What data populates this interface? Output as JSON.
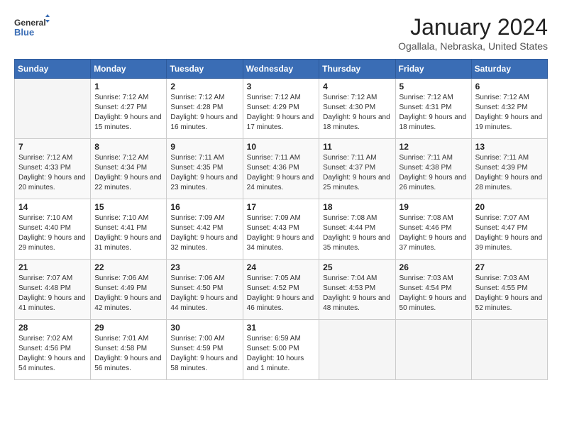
{
  "header": {
    "logo_line1": "General",
    "logo_line2": "Blue",
    "month": "January 2024",
    "location": "Ogallala, Nebraska, United States"
  },
  "weekdays": [
    "Sunday",
    "Monday",
    "Tuesday",
    "Wednesday",
    "Thursday",
    "Friday",
    "Saturday"
  ],
  "weeks": [
    [
      {
        "day": "",
        "sunrise": "",
        "sunset": "",
        "daylight": ""
      },
      {
        "day": "1",
        "sunrise": "Sunrise: 7:12 AM",
        "sunset": "Sunset: 4:27 PM",
        "daylight": "Daylight: 9 hours and 15 minutes."
      },
      {
        "day": "2",
        "sunrise": "Sunrise: 7:12 AM",
        "sunset": "Sunset: 4:28 PM",
        "daylight": "Daylight: 9 hours and 16 minutes."
      },
      {
        "day": "3",
        "sunrise": "Sunrise: 7:12 AM",
        "sunset": "Sunset: 4:29 PM",
        "daylight": "Daylight: 9 hours and 17 minutes."
      },
      {
        "day": "4",
        "sunrise": "Sunrise: 7:12 AM",
        "sunset": "Sunset: 4:30 PM",
        "daylight": "Daylight: 9 hours and 18 minutes."
      },
      {
        "day": "5",
        "sunrise": "Sunrise: 7:12 AM",
        "sunset": "Sunset: 4:31 PM",
        "daylight": "Daylight: 9 hours and 18 minutes."
      },
      {
        "day": "6",
        "sunrise": "Sunrise: 7:12 AM",
        "sunset": "Sunset: 4:32 PM",
        "daylight": "Daylight: 9 hours and 19 minutes."
      }
    ],
    [
      {
        "day": "7",
        "sunrise": "Sunrise: 7:12 AM",
        "sunset": "Sunset: 4:33 PM",
        "daylight": "Daylight: 9 hours and 20 minutes."
      },
      {
        "day": "8",
        "sunrise": "Sunrise: 7:12 AM",
        "sunset": "Sunset: 4:34 PM",
        "daylight": "Daylight: 9 hours and 22 minutes."
      },
      {
        "day": "9",
        "sunrise": "Sunrise: 7:11 AM",
        "sunset": "Sunset: 4:35 PM",
        "daylight": "Daylight: 9 hours and 23 minutes."
      },
      {
        "day": "10",
        "sunrise": "Sunrise: 7:11 AM",
        "sunset": "Sunset: 4:36 PM",
        "daylight": "Daylight: 9 hours and 24 minutes."
      },
      {
        "day": "11",
        "sunrise": "Sunrise: 7:11 AM",
        "sunset": "Sunset: 4:37 PM",
        "daylight": "Daylight: 9 hours and 25 minutes."
      },
      {
        "day": "12",
        "sunrise": "Sunrise: 7:11 AM",
        "sunset": "Sunset: 4:38 PM",
        "daylight": "Daylight: 9 hours and 26 minutes."
      },
      {
        "day": "13",
        "sunrise": "Sunrise: 7:11 AM",
        "sunset": "Sunset: 4:39 PM",
        "daylight": "Daylight: 9 hours and 28 minutes."
      }
    ],
    [
      {
        "day": "14",
        "sunrise": "Sunrise: 7:10 AM",
        "sunset": "Sunset: 4:40 PM",
        "daylight": "Daylight: 9 hours and 29 minutes."
      },
      {
        "day": "15",
        "sunrise": "Sunrise: 7:10 AM",
        "sunset": "Sunset: 4:41 PM",
        "daylight": "Daylight: 9 hours and 31 minutes."
      },
      {
        "day": "16",
        "sunrise": "Sunrise: 7:09 AM",
        "sunset": "Sunset: 4:42 PM",
        "daylight": "Daylight: 9 hours and 32 minutes."
      },
      {
        "day": "17",
        "sunrise": "Sunrise: 7:09 AM",
        "sunset": "Sunset: 4:43 PM",
        "daylight": "Daylight: 9 hours and 34 minutes."
      },
      {
        "day": "18",
        "sunrise": "Sunrise: 7:08 AM",
        "sunset": "Sunset: 4:44 PM",
        "daylight": "Daylight: 9 hours and 35 minutes."
      },
      {
        "day": "19",
        "sunrise": "Sunrise: 7:08 AM",
        "sunset": "Sunset: 4:46 PM",
        "daylight": "Daylight: 9 hours and 37 minutes."
      },
      {
        "day": "20",
        "sunrise": "Sunrise: 7:07 AM",
        "sunset": "Sunset: 4:47 PM",
        "daylight": "Daylight: 9 hours and 39 minutes."
      }
    ],
    [
      {
        "day": "21",
        "sunrise": "Sunrise: 7:07 AM",
        "sunset": "Sunset: 4:48 PM",
        "daylight": "Daylight: 9 hours and 41 minutes."
      },
      {
        "day": "22",
        "sunrise": "Sunrise: 7:06 AM",
        "sunset": "Sunset: 4:49 PM",
        "daylight": "Daylight: 9 hours and 42 minutes."
      },
      {
        "day": "23",
        "sunrise": "Sunrise: 7:06 AM",
        "sunset": "Sunset: 4:50 PM",
        "daylight": "Daylight: 9 hours and 44 minutes."
      },
      {
        "day": "24",
        "sunrise": "Sunrise: 7:05 AM",
        "sunset": "Sunset: 4:52 PM",
        "daylight": "Daylight: 9 hours and 46 minutes."
      },
      {
        "day": "25",
        "sunrise": "Sunrise: 7:04 AM",
        "sunset": "Sunset: 4:53 PM",
        "daylight": "Daylight: 9 hours and 48 minutes."
      },
      {
        "day": "26",
        "sunrise": "Sunrise: 7:03 AM",
        "sunset": "Sunset: 4:54 PM",
        "daylight": "Daylight: 9 hours and 50 minutes."
      },
      {
        "day": "27",
        "sunrise": "Sunrise: 7:03 AM",
        "sunset": "Sunset: 4:55 PM",
        "daylight": "Daylight: 9 hours and 52 minutes."
      }
    ],
    [
      {
        "day": "28",
        "sunrise": "Sunrise: 7:02 AM",
        "sunset": "Sunset: 4:56 PM",
        "daylight": "Daylight: 9 hours and 54 minutes."
      },
      {
        "day": "29",
        "sunrise": "Sunrise: 7:01 AM",
        "sunset": "Sunset: 4:58 PM",
        "daylight": "Daylight: 9 hours and 56 minutes."
      },
      {
        "day": "30",
        "sunrise": "Sunrise: 7:00 AM",
        "sunset": "Sunset: 4:59 PM",
        "daylight": "Daylight: 9 hours and 58 minutes."
      },
      {
        "day": "31",
        "sunrise": "Sunrise: 6:59 AM",
        "sunset": "Sunset: 5:00 PM",
        "daylight": "Daylight: 10 hours and 1 minute."
      },
      {
        "day": "",
        "sunrise": "",
        "sunset": "",
        "daylight": ""
      },
      {
        "day": "",
        "sunrise": "",
        "sunset": "",
        "daylight": ""
      },
      {
        "day": "",
        "sunrise": "",
        "sunset": "",
        "daylight": ""
      }
    ]
  ]
}
